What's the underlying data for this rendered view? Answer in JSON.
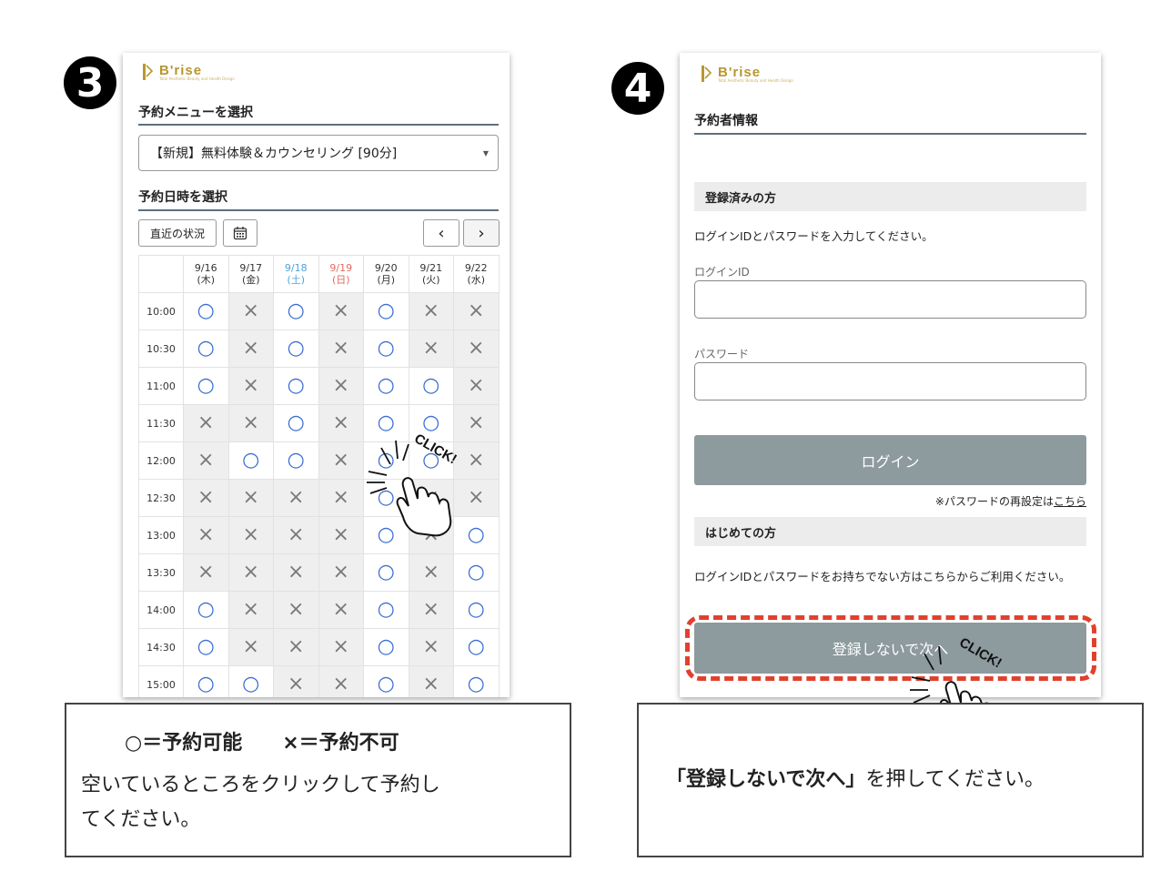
{
  "step3": {
    "number": "3",
    "logo": {
      "name": "B'rise",
      "tagline": "Total Aesthetic Beauty and Health Design"
    },
    "menu_section_title": "予約メニューを選択",
    "menu_selected": "【新規】無料体験＆カウンセリング [90分]",
    "datetime_section_title": "予約日時を選択",
    "recent_button": "直近の状況",
    "prev_icon": "chevron-left-icon",
    "next_icon": "chevron-right-icon",
    "calendar_icon": "calendar-icon",
    "days": [
      {
        "date": "9/16",
        "weekday": "(木)",
        "kind": "weekday"
      },
      {
        "date": "9/17",
        "weekday": "(金)",
        "kind": "weekday"
      },
      {
        "date": "9/18",
        "weekday": "(土)",
        "kind": "sat"
      },
      {
        "date": "9/19",
        "weekday": "(日)",
        "kind": "sun"
      },
      {
        "date": "9/20",
        "weekday": "(月)",
        "kind": "weekday"
      },
      {
        "date": "9/21",
        "weekday": "(火)",
        "kind": "weekday"
      },
      {
        "date": "9/22",
        "weekday": "(水)",
        "kind": "weekday"
      }
    ],
    "slots": [
      {
        "time": "10:00",
        "marks": [
          "○",
          "×",
          "○",
          "×",
          "○",
          "×",
          "×"
        ]
      },
      {
        "time": "10:30",
        "marks": [
          "○",
          "×",
          "○",
          "×",
          "○",
          "×",
          "×"
        ]
      },
      {
        "time": "11:00",
        "marks": [
          "○",
          "×",
          "○",
          "×",
          "○",
          "○",
          "×"
        ]
      },
      {
        "time": "11:30",
        "marks": [
          "×",
          "×",
          "○",
          "×",
          "○",
          "○",
          "×"
        ]
      },
      {
        "time": "12:00",
        "marks": [
          "×",
          "○",
          "○",
          "×",
          "○",
          "○",
          "×"
        ]
      },
      {
        "time": "12:30",
        "marks": [
          "×",
          "×",
          "×",
          "×",
          "○",
          "×",
          "×"
        ]
      },
      {
        "time": "13:00",
        "marks": [
          "×",
          "×",
          "×",
          "×",
          "○",
          "×",
          "○"
        ]
      },
      {
        "time": "13:30",
        "marks": [
          "×",
          "×",
          "×",
          "×",
          "○",
          "×",
          "○"
        ]
      },
      {
        "time": "14:00",
        "marks": [
          "○",
          "×",
          "×",
          "×",
          "○",
          "×",
          "○"
        ]
      },
      {
        "time": "14:30",
        "marks": [
          "○",
          "×",
          "×",
          "×",
          "○",
          "×",
          "○"
        ]
      },
      {
        "time": "15:00",
        "marks": [
          "○",
          "○",
          "×",
          "×",
          "○",
          "×",
          "○"
        ]
      }
    ],
    "click_text": "CLICK!",
    "caption_legend": "○＝予約可能　　×＝予約不可",
    "caption_line1": "空いているところをクリックして予約し",
    "caption_line2": "てください。"
  },
  "step4": {
    "number": "4",
    "logo": {
      "name": "B'rise",
      "tagline": "Total Aesthetic Beauty and Health Design"
    },
    "section_title": "予約者情報",
    "registered_head": "登録済みの方",
    "registered_text": "ログインIDとパスワードを入力してください。",
    "login_id_label": "ログインID",
    "password_label": "パスワード",
    "login_button": "ログイン",
    "pw_reset_prefix": "※パスワードの再設定は",
    "pw_reset_link": "こちら",
    "new_head": "はじめての方",
    "new_text": "ログインIDとパスワードをお持ちでない方はこちらからご利用ください。",
    "skip_button": "登録しないで次へ",
    "click_text": "CLICK!",
    "caption_bold": "「登録しないで次へ」",
    "caption_rest": "を押してください。"
  },
  "colors": {
    "available": "#3b6fd2",
    "unavailable": "#7a7a7a",
    "button_grey": "#8d9a9e",
    "highlight": "#e0412e",
    "brand": "#b8972f"
  }
}
